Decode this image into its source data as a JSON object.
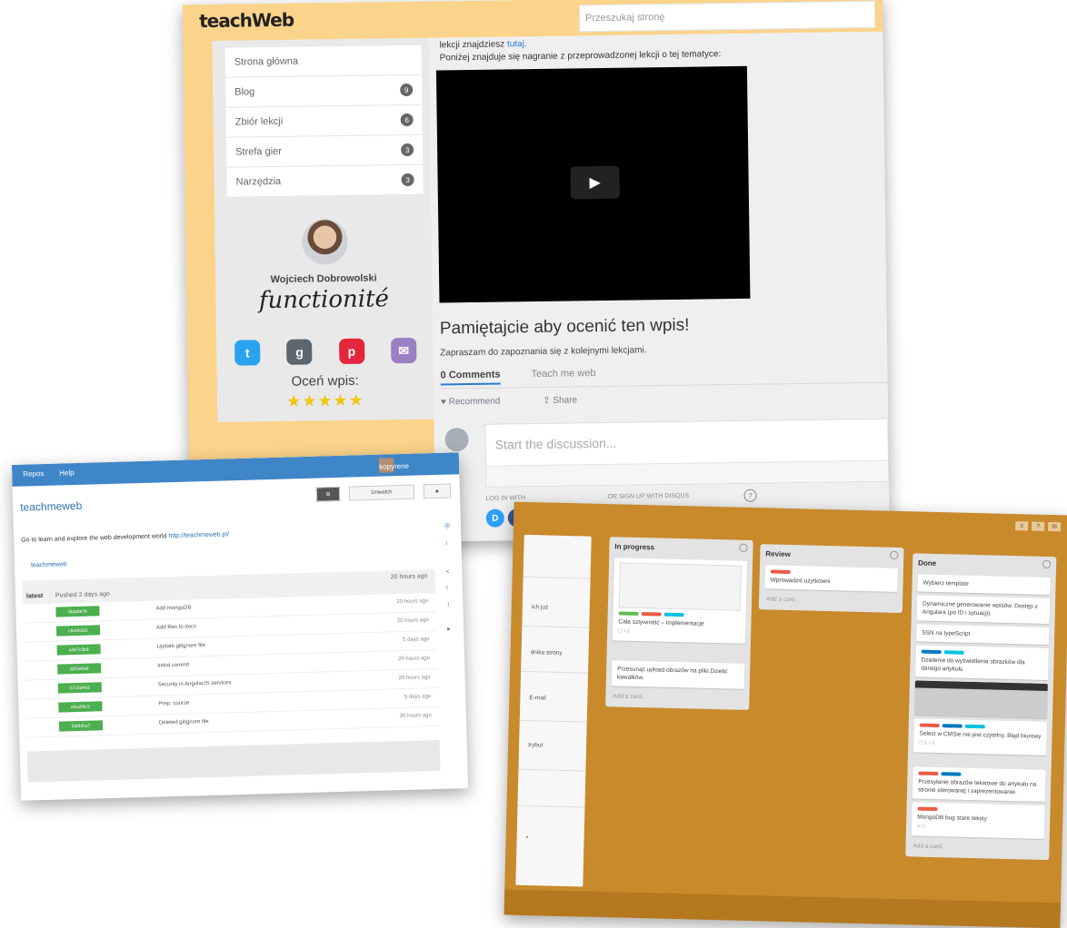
{
  "shot1": {
    "logo": "teachWeb",
    "search_placeholder": "Przeszukaj stronę",
    "menu": [
      {
        "label": "Strona główna",
        "badge": ""
      },
      {
        "label": "Blog",
        "badge": "9"
      },
      {
        "label": "Zbiór lekcji",
        "badge": "6"
      },
      {
        "label": "Strefa gier",
        "badge": "3"
      },
      {
        "label": "Narzędzia",
        "badge": "3"
      }
    ],
    "author": "Wojciech Dobrowolski",
    "brand": "functionité",
    "rate_label": "Oceń wpis:",
    "stars": "★★★★★",
    "lead_prefix": "lekcji znajdziesz",
    "lead_link": "tutaj.",
    "lead_line2": "Poniżej znajduje się nagranie z przeprowadzonej lekcji o tej tematyce:",
    "post_title": "Pamiętajcie aby ocenić ten wpis!",
    "invite": "Zapraszam do zapoznania się z kolejnymi lekcjami.",
    "tab_comments": "0 Comments",
    "tab_site": "Teach me web",
    "recommend": "Recommend",
    "share": "Share",
    "composer_placeholder": "Start the discussion...",
    "log_in_with": "LOG IN WITH",
    "or_sign_up": "OR SIGN UP WITH DISQUS",
    "help": "?"
  },
  "shot2": {
    "nav": [
      "Repos",
      "Help"
    ],
    "username": "kopyrene",
    "repo": "teachmeweb",
    "btn_watch": "Unwatch",
    "btn_star": "★",
    "description": "Go to learn and explore the web development world",
    "description_link": "http://teachmeweb.pl/",
    "navlink": "teachmeweb",
    "table_head_left": "latest",
    "table_head_mid": "Pushed 2 days ago",
    "table_head_age": "20 hours ago",
    "rows": [
      {
        "hash": "f6da0e7b",
        "msg": "Add mongoDB",
        "age": "20 hours ago"
      },
      {
        "hash": "c9a4b2d1",
        "msg": "Add files to docs",
        "age": "20 hours ago"
      },
      {
        "hash": "a4e7c3b8",
        "msg": "Update gitignore file",
        "age": "5 days ago"
      },
      {
        "hash": "d2f1e9a6",
        "msg": "Initial commit",
        "age": "20 hours ago"
      },
      {
        "hash": "b7c5d4e2",
        "msg": "Security in AngularJS services",
        "age": "20 hours ago"
      },
      {
        "hash": "e8a2f6c3",
        "msg": "Prep. course",
        "age": "5 days ago"
      },
      {
        "hash": "f3b9d1a7",
        "msg": "Deleted gitignore file",
        "age": "20 hours ago"
      }
    ]
  },
  "shot3": {
    "top_icons": [
      "≡",
      "?",
      "✉"
    ],
    "left_col": [
      "ich już",
      "dnika strony",
      "E-mail",
      "trybut",
      "•"
    ],
    "lists": [
      {
        "title": "In progress",
        "cards": [
          {
            "text": "Cała sztywność – implementacje",
            "labels": [
              "#61bd4f",
              "#eb5a46",
              "#00c2e0"
            ],
            "meta": "☐ ✓1",
            "image": true
          },
          {
            "text": "Przesunąć upload obrazów na pliki.Dzielić kawałków.",
            "labels": [],
            "meta": ""
          }
        ],
        "add": "Add a card..."
      },
      {
        "title": "Review",
        "cards": [
          {
            "text": "Wprowadzić użytkowni",
            "labels": [
              "#eb5a46"
            ],
            "meta": ""
          }
        ],
        "add": "Add a card..."
      },
      {
        "title": "Done",
        "cards": [
          {
            "text": "Wybierz template",
            "labels": [],
            "meta": ""
          },
          {
            "text": "Dynamiczne generowanie wpisów. Dostęp z Angulara (po ID i sytuacji).",
            "labels": [],
            "meta": ""
          },
          {
            "text": "SSN na typeScript",
            "labels": [],
            "meta": ""
          },
          {
            "text": "Dzielenie do wyświetlenia obrazków dla danego artykułu",
            "labels": [
              "#0079bf",
              "#00c2e0"
            ],
            "meta": "",
            "image": true
          },
          {
            "text": "Select w CMSie nie jest czytelny. Błąd biurowy",
            "labels": [
              "#eb5a46",
              "#0079bf",
              "#00c2e0"
            ],
            "meta": "☐ 1 ✓1"
          },
          {
            "text": "Przesyłanie obrazów tekstowe do artykułu na stronie sterowanej i zaprezentowanie.",
            "labels": [
              "#eb5a46",
              "#0079bf"
            ],
            "meta": ""
          },
          {
            "text": "MongoDB bug stare teksty",
            "labels": [
              "#eb5a46"
            ],
            "meta": "≡ ☐"
          }
        ],
        "add": "Add a card..."
      }
    ]
  },
  "colors": {
    "page_orange": "#fbd38a",
    "nav_blue": "#3f86c8",
    "board_orange": "#c88a2b",
    "twitter": "#2aa3ef",
    "google": "#5b6670",
    "pinterest": "#e3263d",
    "mail": "#9b7fc5",
    "facebook": "#3b5998"
  }
}
